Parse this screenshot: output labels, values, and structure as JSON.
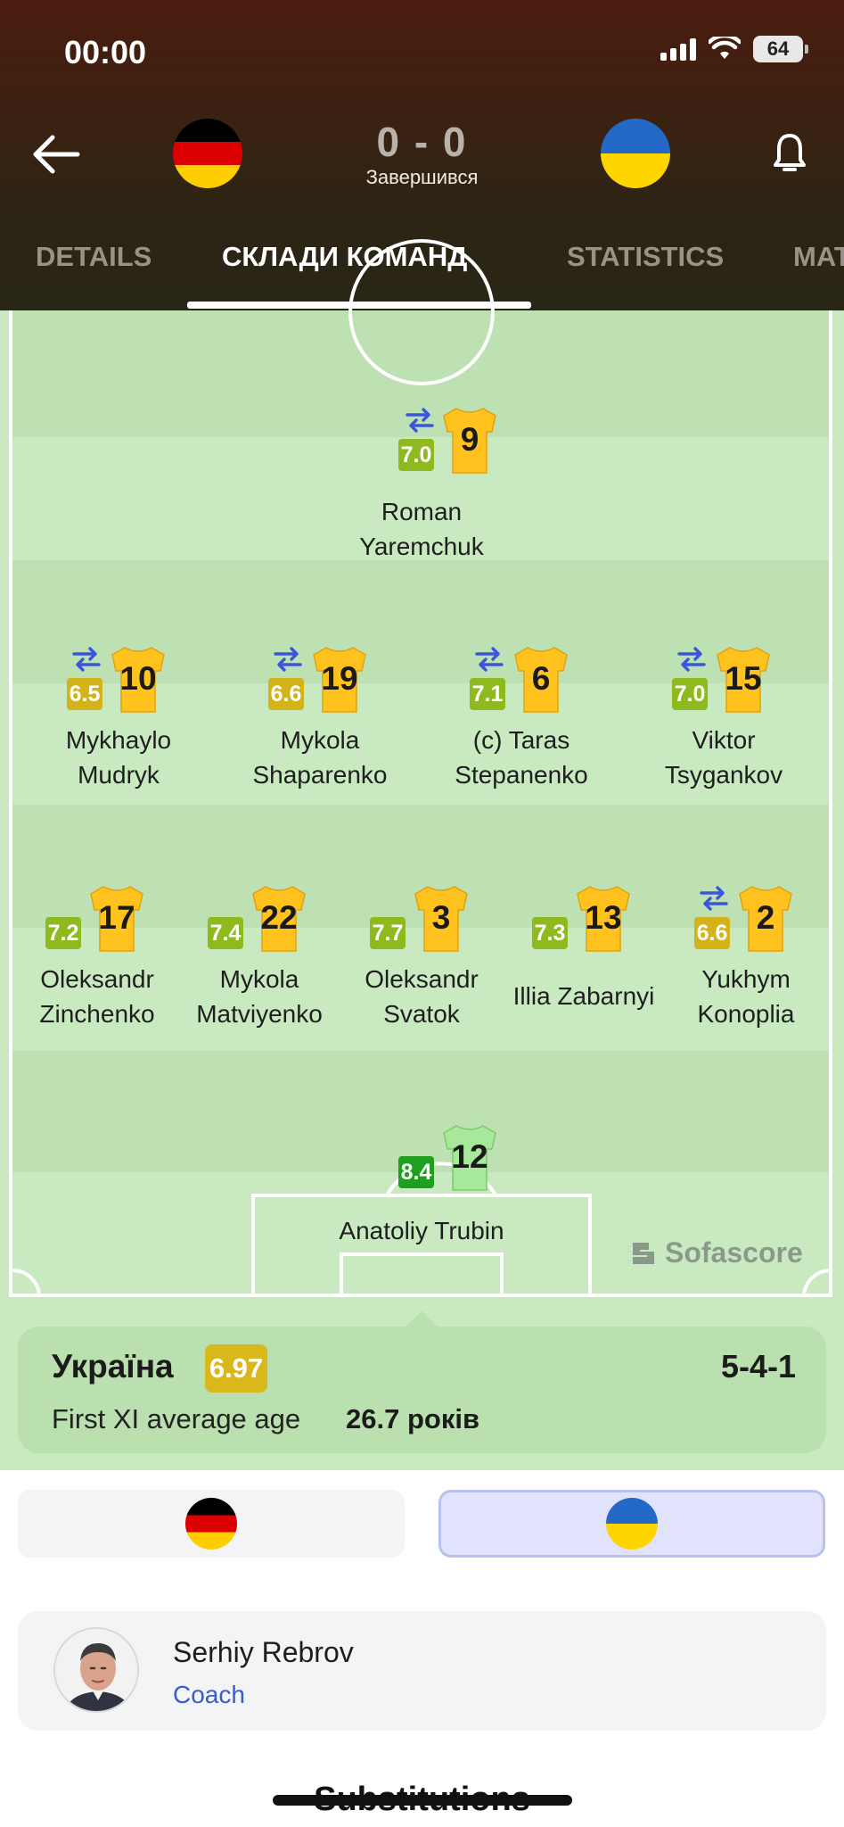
{
  "status_bar": {
    "time": "00:00",
    "battery": "64"
  },
  "match": {
    "home_score": "0",
    "away_score": "0",
    "score_text": "0 - 0",
    "status": "Завершився"
  },
  "tabs": [
    "DETAILS",
    "СКЛАДИ КОМАНД",
    "STATISTICS",
    "MAT"
  ],
  "active_tab": "СКЛАДИ КОМАНД",
  "icons": {
    "back": "arrow-left-icon",
    "bell": "bell-icon",
    "sub": "substitution-arrows-icon",
    "home_flag": "germany-flag-icon",
    "away_flag": "ukraine-flag-icon"
  },
  "lineup": {
    "forward": [
      {
        "number": "9",
        "rating": "7.0",
        "name": "Roman Yaremchuk",
        "subbed": true
      }
    ],
    "midfield": [
      {
        "number": "10",
        "rating": "6.5",
        "name_line1": "Mykhaylo",
        "name_line2": "Mudryk",
        "subbed": true
      },
      {
        "number": "19",
        "rating": "6.6",
        "name_line1": "Mykola",
        "name_line2": "Shaparenko",
        "subbed": true
      },
      {
        "number": "6",
        "rating": "7.1",
        "name_line1": "(c) Taras",
        "name_line2": "Stepanenko",
        "subbed": true
      },
      {
        "number": "15",
        "rating": "7.0",
        "name_line1": "Viktor",
        "name_line2": "Tsygankov",
        "subbed": true
      }
    ],
    "defense": [
      {
        "number": "17",
        "rating": "7.2",
        "name_line1": "Oleksandr",
        "name_line2": "Zinchenko",
        "subbed": false
      },
      {
        "number": "22",
        "rating": "7.4",
        "name_line1": "Mykola",
        "name_line2": "Matviyenko",
        "subbed": false
      },
      {
        "number": "3",
        "rating": "7.7",
        "name_line1": "Oleksandr",
        "name_line2": "Svatok",
        "subbed": false
      },
      {
        "number": "13",
        "rating": "7.3",
        "name_line1": "Illia Zabarnyi",
        "name_line2": "",
        "subbed": false
      },
      {
        "number": "2",
        "rating": "6.6",
        "name_line1": "Yukhym",
        "name_line2": "Konoplia",
        "subbed": true
      }
    ],
    "goalkeeper": {
      "number": "12",
      "rating": "8.4",
      "name": "Anatoliy Trubin"
    }
  },
  "watermark": "Sofascore",
  "team": {
    "name": "Україна",
    "rating": "6.97",
    "formation": "5-4-1",
    "avg_age_label": "First XI average age",
    "avg_age_value": "26.7 років"
  },
  "coach": {
    "name": "Serhiy Rebrov",
    "role": "Coach"
  },
  "section_next": "Substitutions",
  "colors": {
    "rating_green": "#8fba1f",
    "rating_yellow": "#d4b21a",
    "rating_dark_green": "#1f9e1f",
    "rating_yellowgreen": "#a8bc1c",
    "shirt_yellow": "#ffc21f",
    "shirt_gk": "#a8e89a",
    "pitch_light": "#c9eac1",
    "pitch_dark": "#bde1b3",
    "sub_blue": "#3b57d9"
  }
}
